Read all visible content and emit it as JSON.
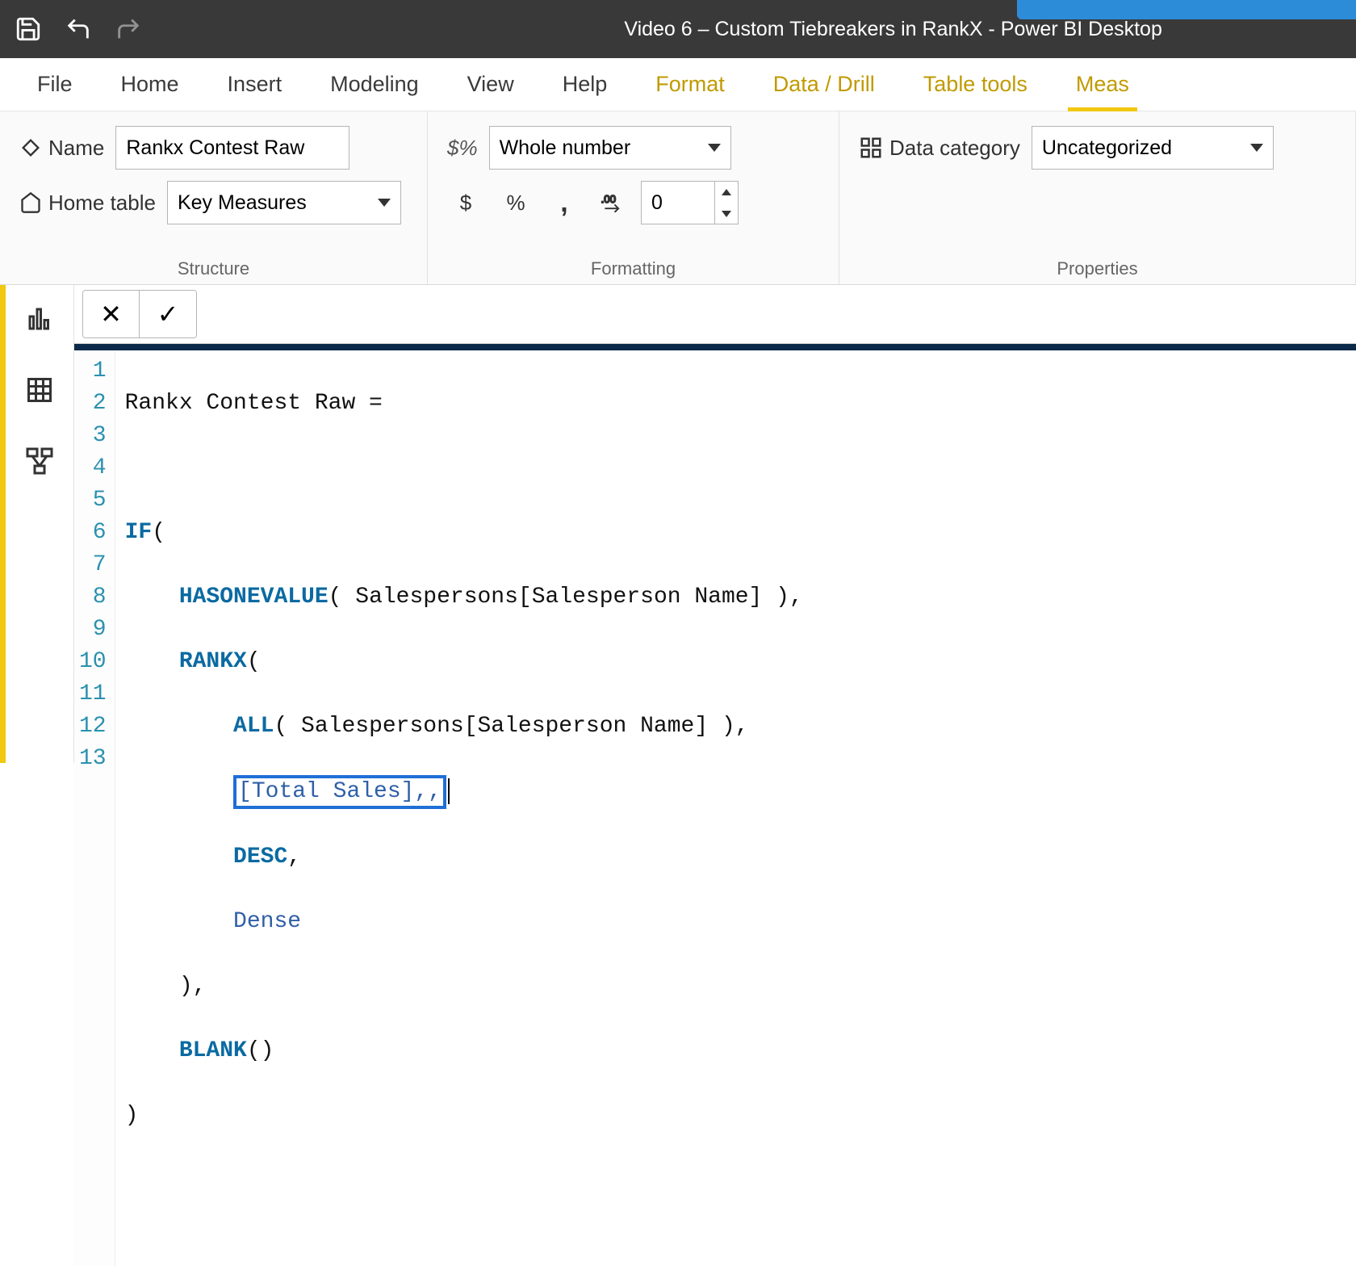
{
  "titlebar": {
    "title": "Video 6 – Custom Tiebreakers in RankX - Power BI Desktop"
  },
  "ribbon_tabs": [
    "File",
    "Home",
    "Insert",
    "Modeling",
    "View",
    "Help",
    "Format",
    "Data / Drill",
    "Table tools",
    "Meas"
  ],
  "ribbon": {
    "name_label": "Name",
    "name_value": "Rankx Contest Raw",
    "home_table_label": "Home table",
    "home_table_value": "Key Measures",
    "format_select": "Whole number",
    "decimal_value": "0",
    "data_category_label": "Data category",
    "data_category_value": "Uncategorized",
    "group_structure": "Structure",
    "group_formatting": "Formatting",
    "group_properties": "Properties"
  },
  "code": {
    "lines": [
      "1",
      "2",
      "3",
      "4",
      "5",
      "6",
      "7",
      "8",
      "9",
      "10",
      "11",
      "12",
      "13"
    ],
    "l1_a": "Rankx Contest Raw = ",
    "l3_if": "IF",
    "l3_paren": "(",
    "l4_fn": "HASONEVALUE",
    "l4_rest": "( Salespersons[Salesperson Name] ),",
    "l5_fn": "RANKX",
    "l5_paren": "(",
    "l6_fn": "ALL",
    "l6_rest": "( Salespersons[Salesperson Name] ),",
    "l7_box": "[Total Sales],,",
    "l8_desc": "DESC",
    "l8_comma": ",",
    "l9_dense": "Dense",
    "l10": "),",
    "l11_fn": "BLANK",
    "l11_rest": "()",
    "l12": ")"
  }
}
